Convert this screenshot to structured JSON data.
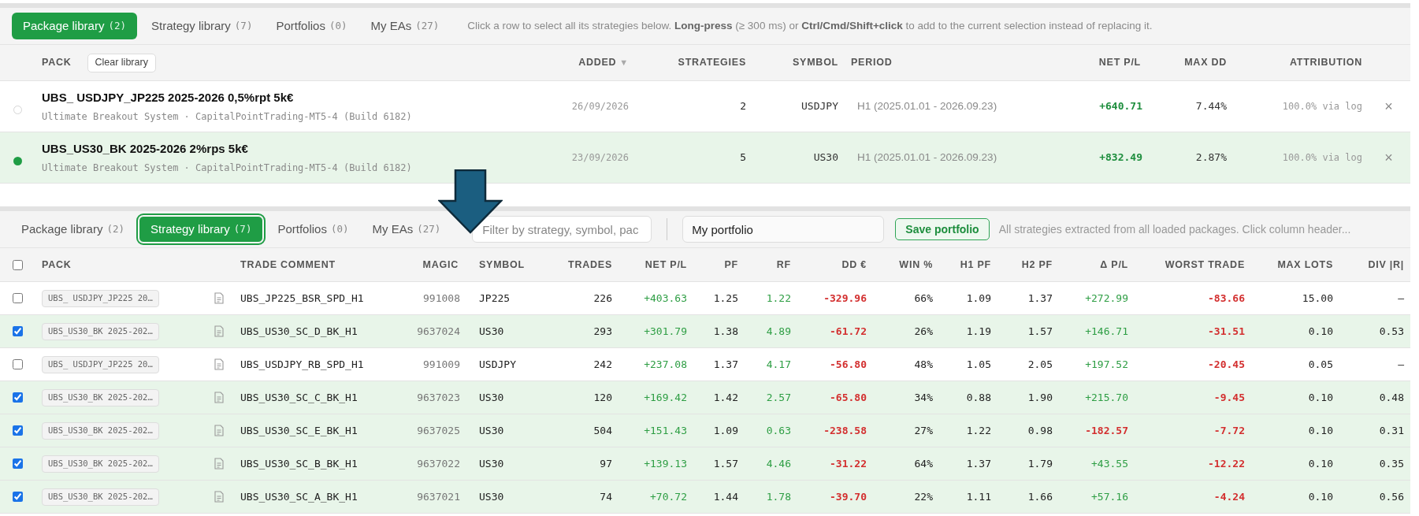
{
  "package_panel": {
    "tabs": [
      {
        "label": "Package library",
        "count": "(2)",
        "selected": true
      },
      {
        "label": "Strategy library",
        "count": "(7)",
        "selected": false
      },
      {
        "label": "Portfolios",
        "count": "(0)",
        "selected": false
      },
      {
        "label": "My EAs",
        "count": "(27)",
        "selected": false
      }
    ],
    "hint": "Click a row to select all its strategies below. **Long-press** (≥ 300 ms) or **Ctrl/Cmd/Shift+click** to add to the current selection instead of replacing it.",
    "clear_button": "Clear library",
    "columns": [
      {
        "label": "PACK"
      },
      {
        "label": "ADDED",
        "sort": "▼"
      },
      {
        "label": "STRATEGIES"
      },
      {
        "label": "SYMBOL"
      },
      {
        "label": "PERIOD"
      },
      {
        "label": "NET P/L"
      },
      {
        "label": "MAX DD"
      },
      {
        "label": "ATTRIBUTION"
      }
    ],
    "rows": [
      {
        "selected": false,
        "name": "UBS_ USDJPY_JP225 2025-2026 0,5%rpt 5k€",
        "subtitle": "Ultimate Breakout System · CapitalPointTrading-MT5-4 (Build 6182)",
        "added": "26/09/2026",
        "strategies": "2",
        "symbol": "USDJPY",
        "period": "H1 (2025.01.01 - 2026.09.23)",
        "net_pl": "+640.71",
        "max_dd": "7.44%",
        "attribution": "100.0% via log",
        "remove": "×"
      },
      {
        "selected": true,
        "name": "UBS_US30_BK 2025-2026 2%rps 5k€",
        "subtitle": "Ultimate Breakout System · CapitalPointTrading-MT5-4 (Build 6182)",
        "added": "23/09/2026",
        "strategies": "5",
        "symbol": "US30",
        "period": "H1 (2025.01.01 - 2026.09.23)",
        "net_pl": "+832.49",
        "max_dd": "2.87%",
        "attribution": "100.0% via log",
        "remove": "×"
      }
    ]
  },
  "strategy_panel": {
    "tabs": [
      {
        "label": "Package library",
        "count": "(2)",
        "selected": false
      },
      {
        "label": "Strategy library",
        "count": "(7)",
        "selected": true
      },
      {
        "label": "Portfolios",
        "count": "(0)",
        "selected": false
      },
      {
        "label": "My EAs",
        "count": "(27)",
        "selected": false
      }
    ],
    "filter": {
      "placeholder": "Filter by strategy, symbol, pac"
    },
    "portfolio_name": {
      "value": "My portfolio"
    },
    "save_button": "Save portfolio",
    "hint": "All strategies extracted from all loaded packages. Click column header...",
    "select_all_checked": false,
    "columns": [
      "PACK",
      "TRADE COMMENT",
      "MAGIC",
      "SYMBOL",
      "TRADES",
      "NET P/L",
      "PF",
      "RF",
      "DD €",
      "WIN %",
      "H1 PF",
      "H2 PF",
      "Δ P/L",
      "WORST TRADE",
      "MAX LOTS",
      "DIV |R|"
    ],
    "rows": [
      {
        "checked": false,
        "pack": "UBS_ USDJPY_JP225 20…",
        "trade_comment": "UBS_JP225_BSR_SPD_H1",
        "magic": "991008",
        "symbol": "JP225",
        "trades": "226",
        "net_pl": "+403.63",
        "pf": "1.25",
        "rf": "1.22",
        "dd": "-329.96",
        "win": "66%",
        "h1_pf": "1.09",
        "h2_pf": "1.37",
        "delta_pl": {
          "text": "+272.99",
          "negative": false
        },
        "worst_trade": "-83.66",
        "max_lots": "15.00",
        "div": "–"
      },
      {
        "checked": true,
        "pack": "UBS_US30_BK 2025-202…",
        "trade_comment": "UBS_US30_SC_D_BK_H1",
        "magic": "9637024",
        "symbol": "US30",
        "trades": "293",
        "net_pl": "+301.79",
        "pf": "1.38",
        "rf": "4.89",
        "dd": "-61.72",
        "win": "26%",
        "h1_pf": "1.19",
        "h2_pf": "1.57",
        "delta_pl": {
          "text": "+146.71",
          "negative": false
        },
        "worst_trade": "-31.51",
        "max_lots": "0.10",
        "div": "0.53"
      },
      {
        "checked": false,
        "pack": "UBS_ USDJPY_JP225 20…",
        "trade_comment": "UBS_USDJPY_RB_SPD_H1",
        "magic": "991009",
        "symbol": "USDJPY",
        "trades": "242",
        "net_pl": "+237.08",
        "pf": "1.37",
        "rf": "4.17",
        "dd": "-56.80",
        "win": "48%",
        "h1_pf": "1.05",
        "h2_pf": "2.05",
        "delta_pl": {
          "text": "+197.52",
          "negative": false
        },
        "worst_trade": "-20.45",
        "max_lots": "0.05",
        "div": "–"
      },
      {
        "checked": true,
        "pack": "UBS_US30_BK 2025-202…",
        "trade_comment": "UBS_US30_SC_C_BK_H1",
        "magic": "9637023",
        "symbol": "US30",
        "trades": "120",
        "net_pl": "+169.42",
        "pf": "1.42",
        "rf": "2.57",
        "dd": "-65.80",
        "win": "34%",
        "h1_pf": "0.88",
        "h2_pf": "1.90",
        "delta_pl": {
          "text": "+215.70",
          "negative": false
        },
        "worst_trade": "-9.45",
        "max_lots": "0.10",
        "div": "0.48"
      },
      {
        "checked": true,
        "pack": "UBS_US30_BK 2025-202…",
        "trade_comment": "UBS_US30_SC_E_BK_H1",
        "magic": "9637025",
        "symbol": "US30",
        "trades": "504",
        "net_pl": "+151.43",
        "pf": "1.09",
        "rf": "0.63",
        "dd": "-238.58",
        "win": "27%",
        "h1_pf": "1.22",
        "h2_pf": "0.98",
        "delta_pl": {
          "text": "-182.57",
          "negative": true
        },
        "worst_trade": "-7.72",
        "max_lots": "0.10",
        "div": "0.31"
      },
      {
        "checked": true,
        "pack": "UBS_US30_BK 2025-202…",
        "trade_comment": "UBS_US30_SC_B_BK_H1",
        "magic": "9637022",
        "symbol": "US30",
        "trades": "97",
        "net_pl": "+139.13",
        "pf": "1.57",
        "rf": "4.46",
        "dd": "-31.22",
        "win": "64%",
        "h1_pf": "1.37",
        "h2_pf": "1.79",
        "delta_pl": {
          "text": "+43.55",
          "negative": false
        },
        "worst_trade": "-12.22",
        "max_lots": "0.10",
        "div": "0.35"
      },
      {
        "checked": true,
        "pack": "UBS_US30_BK 2025-202…",
        "trade_comment": "UBS_US30_SC_A_BK_H1",
        "magic": "9637021",
        "symbol": "US30",
        "trades": "74",
        "net_pl": "+70.72",
        "pf": "1.44",
        "rf": "1.78",
        "dd": "-39.70",
        "win": "22%",
        "h1_pf": "1.11",
        "h2_pf": "1.66",
        "delta_pl": {
          "text": "+57.16",
          "negative": false
        },
        "worst_trade": "-4.24",
        "max_lots": "0.10",
        "div": "0.56"
      }
    ]
  }
}
